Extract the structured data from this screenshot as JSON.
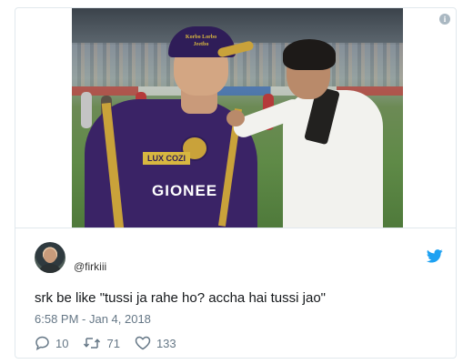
{
  "tweet": {
    "handle": "@firkiii",
    "text": "srk be like \"tussi ja rahe ho? accha hai tussi jao\"",
    "timestamp": "6:58 PM - Jan 4, 2018",
    "replies": "10",
    "retweets": "71",
    "likes": "133"
  },
  "photo": {
    "cap_text": "Korbo Lorbo Jeetbo",
    "sponsor_badge": "LUX COZI",
    "sponsor_main": "GIONEE"
  },
  "icons": {
    "info": "info-icon",
    "brand": "twitter-bird-icon",
    "reply": "reply-icon",
    "retweet": "retweet-icon",
    "like": "heart-icon"
  },
  "colors": {
    "twitter_blue": "#1da1f2",
    "muted_text": "#657786",
    "border": "#e1e8ed"
  }
}
